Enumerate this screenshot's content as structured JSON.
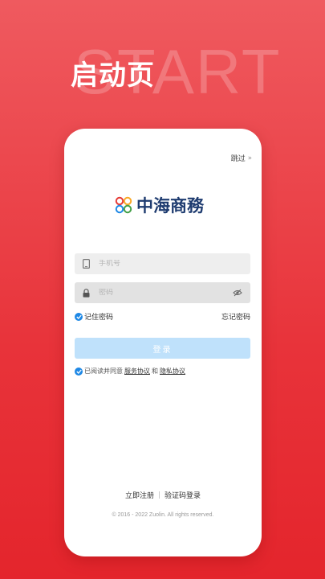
{
  "hero": {
    "title": "启动页",
    "bg_word": "START"
  },
  "card": {
    "skip_label": "跳过",
    "brand_name": "中海商務",
    "phone_field": {
      "placeholder": "手机号",
      "value": ""
    },
    "password_field": {
      "placeholder": "密码",
      "value": ""
    },
    "remember_label": "记住密码",
    "forgot_label": "忘记密码",
    "login_label": "登录",
    "agreement": {
      "prefix": "已阅读并同意",
      "service_link": "服务协议",
      "and": "和",
      "privacy_link": "隐私协议"
    },
    "register_label": "立即注册",
    "sms_login_label": "验证码登录",
    "copyright": "© 2016 - 2022 Zuolin. All rights reserved."
  },
  "colors": {
    "background_top": "#ef5a5f",
    "background_bottom": "#e4252c",
    "accent_blue": "#1e88e5",
    "login_disabled": "#bfe1fb",
    "brand_navy": "#1f3c70"
  },
  "icons": [
    "skip-chevrons-icon",
    "brand-logo-icon",
    "phone-icon",
    "lock-icon",
    "eye-off-icon",
    "check-icon"
  ]
}
